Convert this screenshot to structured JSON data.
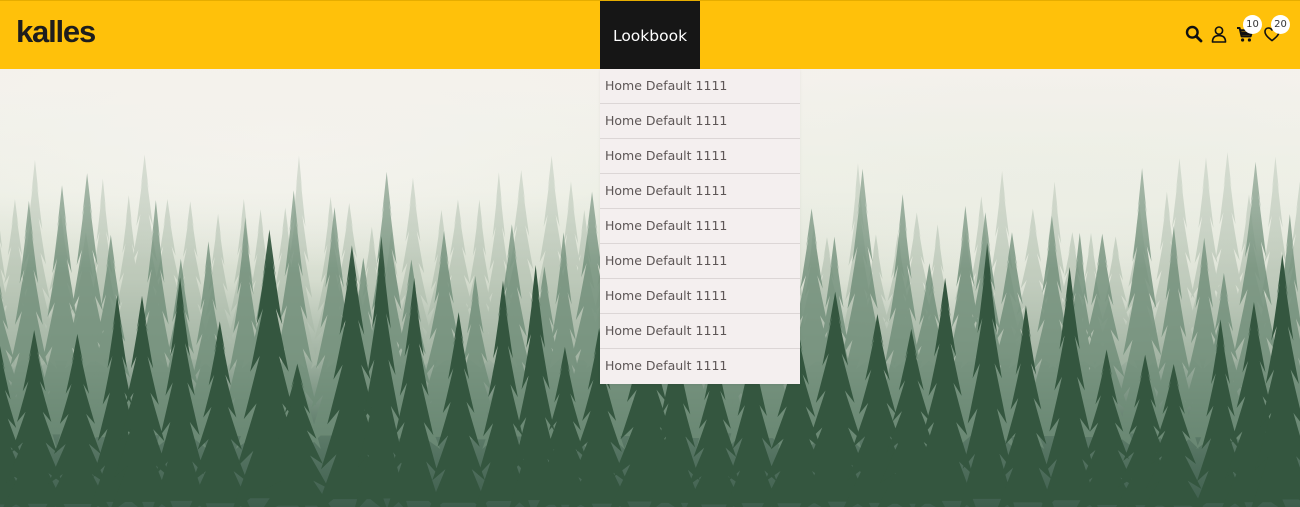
{
  "brand": {
    "logo_text": "kalles"
  },
  "nav": {
    "active_item": "Lookbook"
  },
  "dropdown": {
    "items": [
      "Home Default 1111",
      "Home Default 1111",
      "Home Default 1111",
      "Home Default 1111",
      "Home Default 1111",
      "Home Default 1111",
      "Home Default 1111",
      "Home Default 1111",
      "Home Default 1111"
    ]
  },
  "header_icons": {
    "search": "search-icon",
    "account": "user-icon",
    "cart": "cart-icon",
    "wishlist": "heart-icon",
    "cart_count": "10",
    "wishlist_count": "20"
  },
  "colors": {
    "header_bg": "#ffc10a",
    "nav_active_bg": "#161616",
    "dropdown_bg": "#f4efef"
  }
}
